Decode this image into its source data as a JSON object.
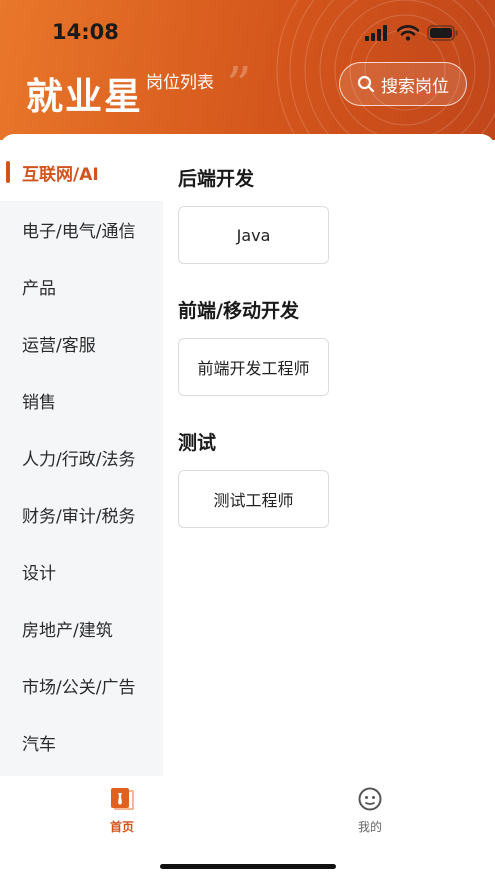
{
  "status_bar": {
    "time": "14:08"
  },
  "header": {
    "brand": "就业星",
    "subtitle": "岗位列表",
    "search_label": "搜索岗位"
  },
  "sidebar": {
    "items": [
      {
        "label": "互联网/AI",
        "active": true
      },
      {
        "label": "电子/电气/通信"
      },
      {
        "label": "产品"
      },
      {
        "label": "运营/客服"
      },
      {
        "label": "销售"
      },
      {
        "label": "人力/行政/法务"
      },
      {
        "label": "财务/审计/税务"
      },
      {
        "label": "设计"
      },
      {
        "label": "房地产/建筑"
      },
      {
        "label": "市场/公关/广告"
      },
      {
        "label": "汽车"
      }
    ]
  },
  "main": {
    "groups": [
      {
        "title": "后端开发",
        "jobs": [
          "Java"
        ]
      },
      {
        "title": "前端/移动开发",
        "jobs": [
          "前端开发工程师"
        ]
      },
      {
        "title": "测试",
        "jobs": [
          "测试工程师"
        ]
      }
    ]
  },
  "tabbar": {
    "home_label": "首页",
    "me_label": "我的"
  },
  "colors": {
    "accent": "#d2541c",
    "header_start": "#e9772a",
    "header_end": "#c1461a"
  }
}
